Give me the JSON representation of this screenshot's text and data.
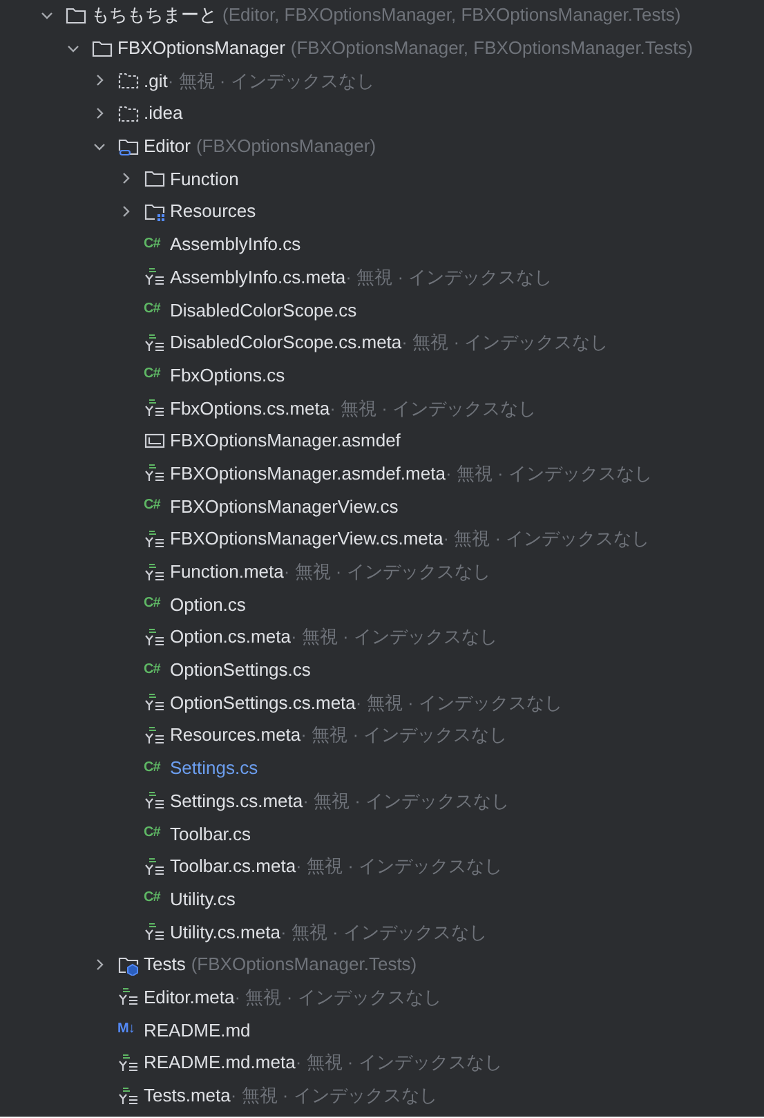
{
  "tree": [
    {
      "kind": "folder",
      "name": "もちもちまーと",
      "annotation": "(Editor, FBXOptionsManager, FBXOptionsManager.Tests)",
      "expanded": true,
      "children": [
        {
          "kind": "folder",
          "name": "FBXOptionsManager",
          "annotation": "(FBXOptionsManager, FBXOptionsManager.Tests)",
          "expanded": true,
          "children": [
            {
              "kind": "excluded-folder",
              "name": ".git",
              "status": "· 無視 · インデックスなし",
              "expanded": false
            },
            {
              "kind": "excluded-folder",
              "name": ".idea",
              "expanded": false
            },
            {
              "kind": "source-folder",
              "name": "Editor",
              "annotation": "(FBXOptionsManager)",
              "expanded": true,
              "children": [
                {
                  "kind": "folder",
                  "name": "Function",
                  "expanded": false
                },
                {
                  "kind": "resources-folder",
                  "name": "Resources",
                  "expanded": false
                },
                {
                  "kind": "cs",
                  "glyph": "C#",
                  "name": "AssemblyInfo.cs",
                  "modified": false
                },
                {
                  "kind": "meta",
                  "name": "AssemblyInfo.cs.meta",
                  "status": "· 無視 · インデックスなし"
                },
                {
                  "kind": "cs",
                  "glyph": "C#",
                  "name": "DisabledColorScope.cs",
                  "modified": false
                },
                {
                  "kind": "meta",
                  "name": "DisabledColorScope.cs.meta",
                  "status": "· 無視 · インデックスなし"
                },
                {
                  "kind": "cs",
                  "glyph": "C#",
                  "name": "FbxOptions.cs",
                  "modified": false
                },
                {
                  "kind": "meta",
                  "name": "FbxOptions.cs.meta",
                  "status": "· 無視 · インデックスなし"
                },
                {
                  "kind": "asmdef",
                  "name": "FBXOptionsManager.asmdef"
                },
                {
                  "kind": "meta",
                  "name": "FBXOptionsManager.asmdef.meta",
                  "status": "· 無視 · インデックスなし"
                },
                {
                  "kind": "cs",
                  "glyph": "C#",
                  "name": "FBXOptionsManagerView.cs",
                  "modified": false
                },
                {
                  "kind": "meta",
                  "name": "FBXOptionsManagerView.cs.meta",
                  "status": "· 無視 · インデックスなし"
                },
                {
                  "kind": "meta",
                  "name": "Function.meta",
                  "status": "· 無視 · インデックスなし"
                },
                {
                  "kind": "cs",
                  "glyph": "C#",
                  "name": "Option.cs",
                  "modified": false
                },
                {
                  "kind": "meta",
                  "name": "Option.cs.meta",
                  "status": "· 無視 · インデックスなし"
                },
                {
                  "kind": "cs",
                  "glyph": "C#",
                  "name": "OptionSettings.cs",
                  "modified": false
                },
                {
                  "kind": "meta",
                  "name": "OptionSettings.cs.meta",
                  "status": "· 無視 · インデックスなし"
                },
                {
                  "kind": "meta",
                  "name": "Resources.meta",
                  "status": "· 無視 · インデックスなし"
                },
                {
                  "kind": "cs",
                  "glyph": "C#",
                  "name": "Settings.cs",
                  "modified": true
                },
                {
                  "kind": "meta",
                  "name": "Settings.cs.meta",
                  "status": "· 無視 · インデックスなし"
                },
                {
                  "kind": "cs",
                  "glyph": "C#",
                  "name": "Toolbar.cs",
                  "modified": false
                },
                {
                  "kind": "meta",
                  "name": "Toolbar.cs.meta",
                  "status": "· 無視 · インデックスなし"
                },
                {
                  "kind": "cs",
                  "glyph": "C#",
                  "name": "Utility.cs",
                  "modified": false
                },
                {
                  "kind": "meta",
                  "name": "Utility.cs.meta",
                  "status": "· 無視 · インデックスなし"
                }
              ]
            },
            {
              "kind": "test-folder",
              "name": "Tests",
              "annotation": "(FBXOptionsManager.Tests)",
              "expanded": false
            },
            {
              "kind": "meta",
              "name": "Editor.meta",
              "status": "· 無視 · インデックスなし"
            },
            {
              "kind": "md",
              "glyph": "M↓",
              "name": "README.md"
            },
            {
              "kind": "meta",
              "name": "README.md.meta",
              "status": "· 無視 · インデックスなし"
            },
            {
              "kind": "meta",
              "name": "Tests.meta",
              "status": "· 無視 · インデックスなし"
            }
          ]
        }
      ]
    }
  ]
}
